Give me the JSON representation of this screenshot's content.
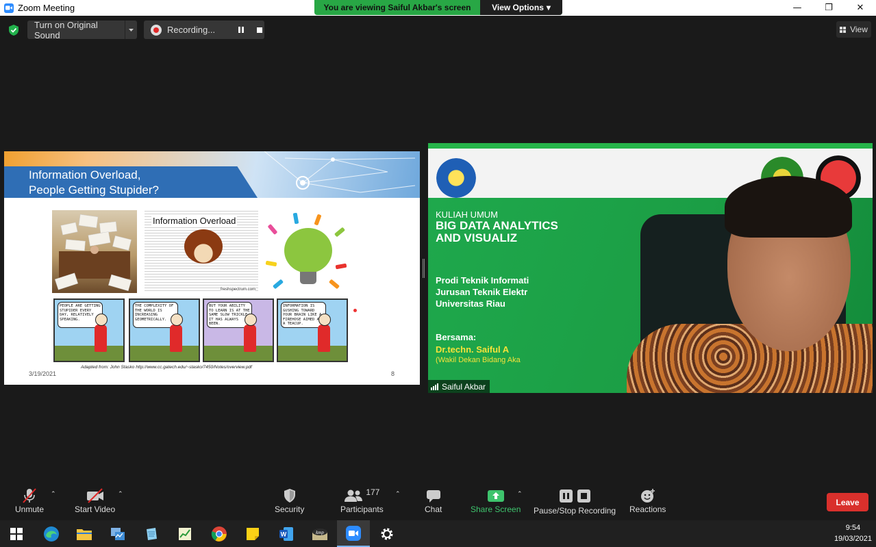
{
  "window": {
    "title": "Zoom Meeting",
    "minimize_glyph": "—",
    "restore_glyph": "❐",
    "close_glyph": "✕"
  },
  "banner": {
    "message": "You are viewing Saiful Akbar's screen",
    "view_options": "View Options",
    "view_options_caret": "▾"
  },
  "topbar": {
    "original_sound": "Turn on Original Sound",
    "recording": "Recording...",
    "view": "View"
  },
  "slide": {
    "title": "Information Overload,\nPeople Getting Stupider?",
    "image_caption": "Information Overload",
    "image_source": "freshspectrum.com",
    "comics": [
      "People are getting stupider every day, relatively speaking.",
      "The complexity of the world is increasing geometrically.",
      "But your ability to learn is at the same slow trickle it has always been.",
      "Information is gushing toward your brain like a firehose aimed at a teacup."
    ],
    "credit": "Adapted from: John Stasko http://www.cc.gatech.edu/~stasko/7450/Notes/overview.pdf",
    "date": "3/19/2021",
    "page": "8"
  },
  "video": {
    "line1": "KULIAH UMUM",
    "line2": "BIG DATA ANALYTICS",
    "line3": "AND VISUALIZ",
    "line4": "Prodi Teknik Informati",
    "line5": "Jurusan Teknik Elektr",
    "line6": "Universitas Riau",
    "line7": "Bersama:",
    "line8": "Dr.techn. Saiful A",
    "line9": "(Wakil Dekan Bidang Aka",
    "participant_name": "Saiful Akbar"
  },
  "toolbar": {
    "unmute": "Unmute",
    "start_video": "Start Video",
    "security": "Security",
    "participants": "Participants",
    "participants_count": "177",
    "chat": "Chat",
    "share_screen": "Share Screen",
    "pause_stop_recording": "Pause/Stop Recording",
    "reactions": "Reactions",
    "leave": "Leave",
    "caret": "⌃"
  },
  "taskbar": {
    "time": "9:54",
    "date": "19/03/2021",
    "apps": [
      "windows-start",
      "edge",
      "file-explorer",
      "task-manager",
      "notepad",
      "spreadsheet",
      "chrome",
      "sticky-notes",
      "word",
      "kmplayer",
      "zoom",
      "settings"
    ]
  },
  "colors": {
    "banner_green": "#28a745",
    "leave_red": "#d9302c",
    "share_green": "#3ec46d",
    "recording_red": "#e02828"
  }
}
